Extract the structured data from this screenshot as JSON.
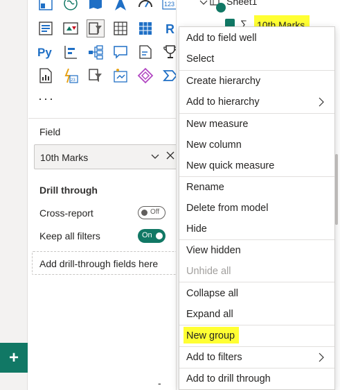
{
  "left_strip": {
    "add_page_label": "+"
  },
  "visualizations": {
    "icons": [
      "map-icon",
      "globe-icon",
      "filled-map-icon",
      "azure-map-icon",
      "gauge-icon",
      "card-number-icon",
      "multi-row-card-icon",
      "kpi-icon",
      "slicer-icon",
      "table-icon",
      "matrix-icon",
      "r-visual-icon",
      "python-visual-icon",
      "key-influencers-icon",
      "decomposition-tree-icon",
      "qa-icon",
      "smart-narrative-icon",
      "goals-icon",
      "paginated-report-icon",
      "power-apps-icon",
      "power-automate-icon",
      "smart-format-icon",
      "diamond-visual-icon",
      "chevron-visual-icon"
    ],
    "card_number_text": "123",
    "r_text": "R",
    "py_text": "Py",
    "more_label": "···"
  },
  "field_section": {
    "label": "Field",
    "field_value": "10th Marks"
  },
  "drill_through": {
    "title": "Drill through",
    "cross_report_label": "Cross-report",
    "cross_report_state": "Off",
    "keep_filters_label": "Keep all filters",
    "keep_filters_state": "On",
    "drop_placeholder": "Add drill-through fields here"
  },
  "fields_pane": {
    "table_name": "Sheet1",
    "field_name": "10th Marks",
    "sigma": "∑"
  },
  "context_menu": {
    "items": [
      {
        "label": "Add to field well"
      },
      {
        "label": "Select"
      },
      {
        "label": "Create hierarchy"
      },
      {
        "label": "Add to hierarchy"
      },
      {
        "label": "New measure"
      },
      {
        "label": "New column"
      },
      {
        "label": "New quick measure"
      },
      {
        "label": "Rename"
      },
      {
        "label": "Delete from model"
      },
      {
        "label": "Hide"
      },
      {
        "label": "View hidden"
      },
      {
        "label": "Unhide all"
      },
      {
        "label": "Collapse all"
      },
      {
        "label": "Expand all"
      },
      {
        "label": "New group"
      },
      {
        "label": "Add to filters"
      },
      {
        "label": "Add to drill through"
      }
    ]
  },
  "bottom_bar": {
    "dash": "-"
  },
  "colors": {
    "accent": "#117865",
    "highlight": "#ffff33",
    "icon_blue": "#1f6fc5"
  }
}
